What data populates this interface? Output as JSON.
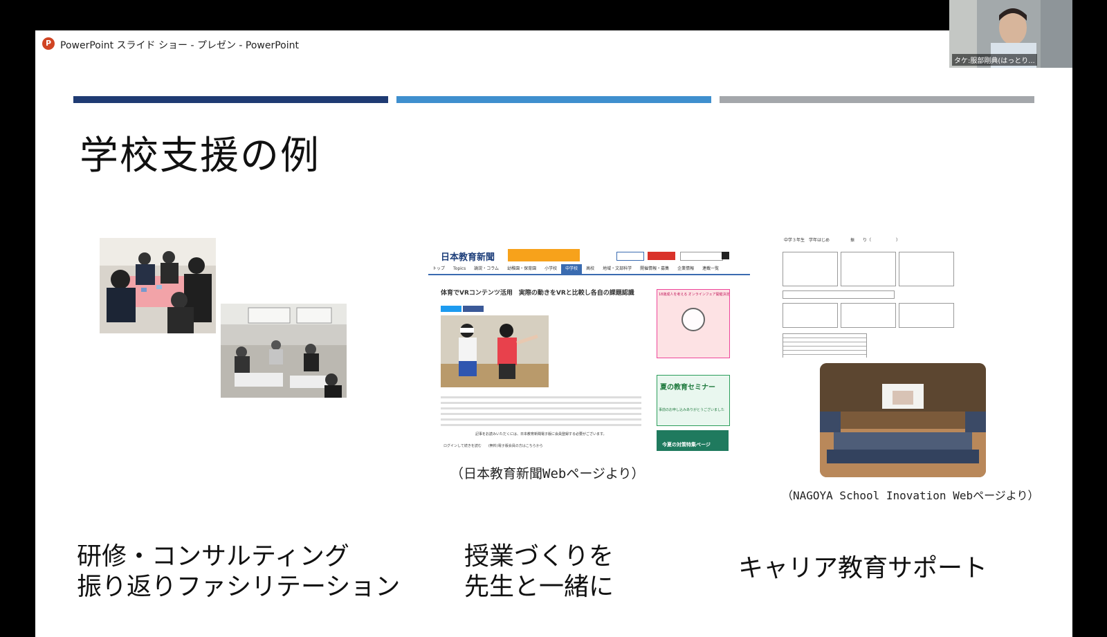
{
  "window": {
    "app_title": "PowerPoint スライド ショー  -  プレゼン - PowerPoint",
    "icon": "powerpoint-icon"
  },
  "webcam": {
    "name": "タケ:服部剛典(はっとり..."
  },
  "slide": {
    "title": "学校支援の例",
    "bars": [
      "#1f3b73",
      "#3f8fce",
      "#a4a7ab"
    ],
    "columns": [
      {
        "label_line1": "研修・コンサルティング",
        "label_line2": "振り返りファシリテーション"
      },
      {
        "caption": "（日本教育新聞Webページより）",
        "label_line1": "授業づくりを",
        "label_line2": "先生と一緒に"
      },
      {
        "caption": "（NAGOYA School Inovation Webページより）",
        "label_line1": "キャリア教育サポート"
      }
    ]
  },
  "news_page": {
    "logo": "日本教育新聞",
    "nav": [
      "トップ",
      "Topics",
      "論説・コラム",
      "幼稚園・保育園",
      "小学校",
      "中学校",
      "高校",
      "地域・文部科学",
      "開催情報・募集",
      "企業情報",
      "連載一覧"
    ],
    "headline": "体育でVRコンテンツ活用　実際の動きをVRと比較し各自の課題認識",
    "ad1": "18歳成人を考える オンラインフェア開催決定",
    "ad2": "夏の教育セミナー",
    "ad2_sub": "事前のお申し込みありがとうございました",
    "ad3": "今夏の対策特集ページ",
    "notice": "記事をお読みいただくには、日本教育新聞電子版に会員登録する必要がございます。",
    "login": "ログインして続きを読む　　(無料)電子版会員の方はこちらから"
  },
  "worksheet": {
    "title": "中学３年生　学年はじめ　　　　　振　　り（　　　　　　）"
  }
}
